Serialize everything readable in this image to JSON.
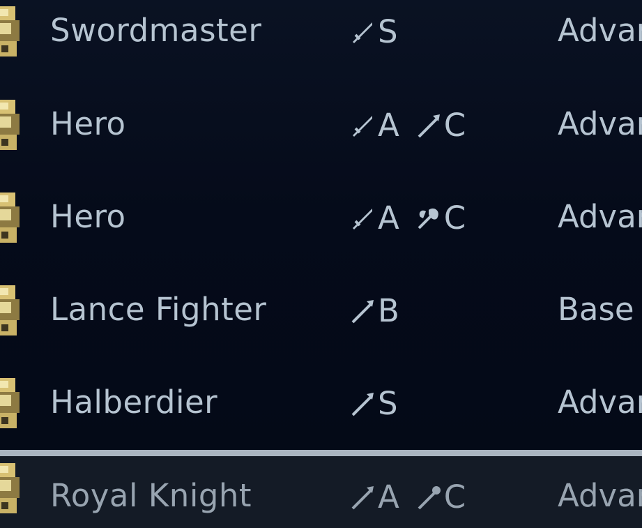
{
  "classes": [
    {
      "name": "Swordmaster",
      "proficiencies": [
        {
          "icon": "sword-icon",
          "rank": "S"
        }
      ],
      "tier": "Advan"
    },
    {
      "name": "Hero",
      "proficiencies": [
        {
          "icon": "sword-icon",
          "rank": "A"
        },
        {
          "icon": "lance-icon",
          "rank": "C"
        }
      ],
      "tier": "Advan"
    },
    {
      "name": "Hero",
      "proficiencies": [
        {
          "icon": "sword-icon",
          "rank": "A"
        },
        {
          "icon": "axe-icon",
          "rank": "C"
        }
      ],
      "tier": "Advan"
    },
    {
      "name": "Lance Fighter",
      "proficiencies": [
        {
          "icon": "lance-icon",
          "rank": "B"
        }
      ],
      "tier": "Base"
    },
    {
      "name": "Halberdier",
      "proficiencies": [
        {
          "icon": "lance-icon",
          "rank": "S"
        }
      ],
      "tier": "Advan"
    },
    {
      "name": "Royal Knight",
      "proficiencies": [
        {
          "icon": "lance-icon",
          "rank": "A"
        },
        {
          "icon": "staff-icon",
          "rank": "C"
        }
      ],
      "tier": "Advan",
      "selected": true
    }
  ],
  "colors": {
    "background": "#050a18",
    "text": "#b6c4d1",
    "selected_row": "#141b26",
    "selected_border": "#aab5c0",
    "sprite_gold": "#d8c173"
  }
}
